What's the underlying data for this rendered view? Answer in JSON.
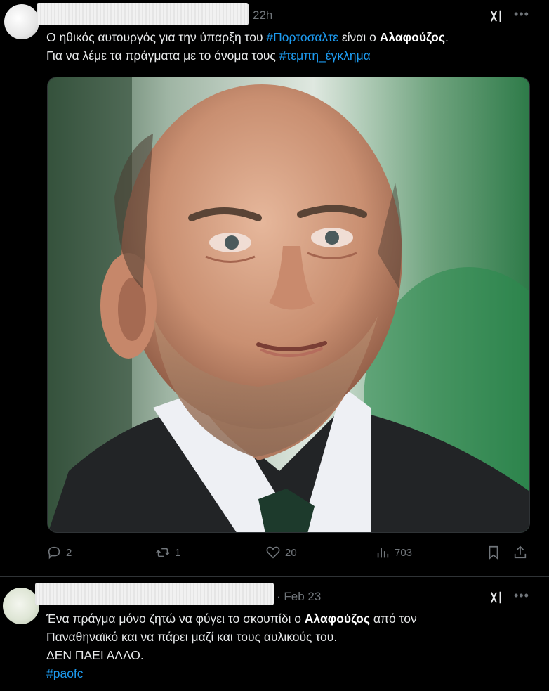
{
  "tweets": [
    {
      "time": "22h",
      "text": {
        "line1_a": "Ο ηθικός αυτουργός για την ύπαρξη του ",
        "line1_tag": "#Πορτοσαλτε",
        "line1_b": " είναι ο ",
        "line1_bold": "Αλαφούζος",
        "line1_end": ".",
        "line2_a": "Για να λέμε τα πράγματα με το όνομα τους ",
        "line2_tag": "#τεμπη_έγκλημα"
      },
      "actions": {
        "replies": "2",
        "reposts": "1",
        "likes": "20",
        "views": "703"
      }
    },
    {
      "time": "· Feb 23",
      "text": {
        "line1_a": "Ένα πράγμα μόνο ζητώ να φύγει το σκουπίδι ο ",
        "line1_bold": "Αλαφούζος",
        "line1_b": " από τον",
        "line2": "Παναθηναϊκό και να πάρει μαζί και τους αυλικούς του.",
        "line3": "ΔΕΝ ΠΑΕΙ ΑΛΛΟ.",
        "line4_tag": "#paofc"
      }
    }
  ],
  "icons": {
    "grok": "grok-icon",
    "more": "more-icon",
    "reply": "reply-icon",
    "repost": "repost-icon",
    "like": "like-icon",
    "views": "views-icon",
    "bookmark": "bookmark-icon",
    "share": "share-icon"
  },
  "colors": {
    "background": "#000000",
    "text": "#e7e9ea",
    "secondary": "#71767b",
    "link": "#1d9bf0",
    "divider": "#2f3336"
  }
}
